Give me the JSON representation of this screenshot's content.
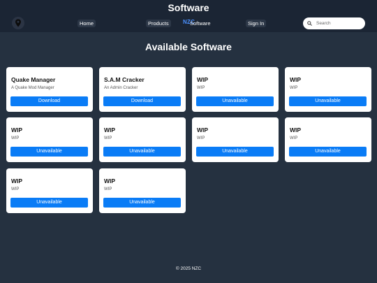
{
  "header": {
    "title": "Software",
    "nav": {
      "home": "Home",
      "products": "Products",
      "brand": "NZC",
      "software": "Software",
      "signin": "Sign In"
    },
    "search_placeholder": "Search"
  },
  "main": {
    "heading": "Available Software",
    "cards": [
      {
        "title": "Quake Manager",
        "desc": "A Quake Mod Manager",
        "button": "Download"
      },
      {
        "title": "S.A.M Cracker",
        "desc": "An Admin Cracker",
        "button": "Download"
      },
      {
        "title": "WIP",
        "desc": "WIP",
        "button": "Unavailable"
      },
      {
        "title": "WIP",
        "desc": "WIP",
        "button": "Unavailable"
      },
      {
        "title": "WIP",
        "desc": "WIP",
        "button": "Unavailable"
      },
      {
        "title": "WIP",
        "desc": "WIP",
        "button": "Unavailable"
      },
      {
        "title": "WIP",
        "desc": "WIP",
        "button": "Unavailable"
      },
      {
        "title": "WIP",
        "desc": "WIP",
        "button": "Unavailable"
      },
      {
        "title": "WIP",
        "desc": "WIP",
        "button": "Unavailable"
      },
      {
        "title": "WIP",
        "desc": "WIP",
        "button": "Unavailable"
      }
    ]
  },
  "footer": {
    "text": "© 2025 NZC"
  },
  "colors": {
    "background": "#253140",
    "header": "#1b2534",
    "button": "#0a7cf6",
    "brand": "#4a90ff"
  },
  "icons": {
    "logo": "map-pin-icon",
    "search": "search-icon"
  }
}
